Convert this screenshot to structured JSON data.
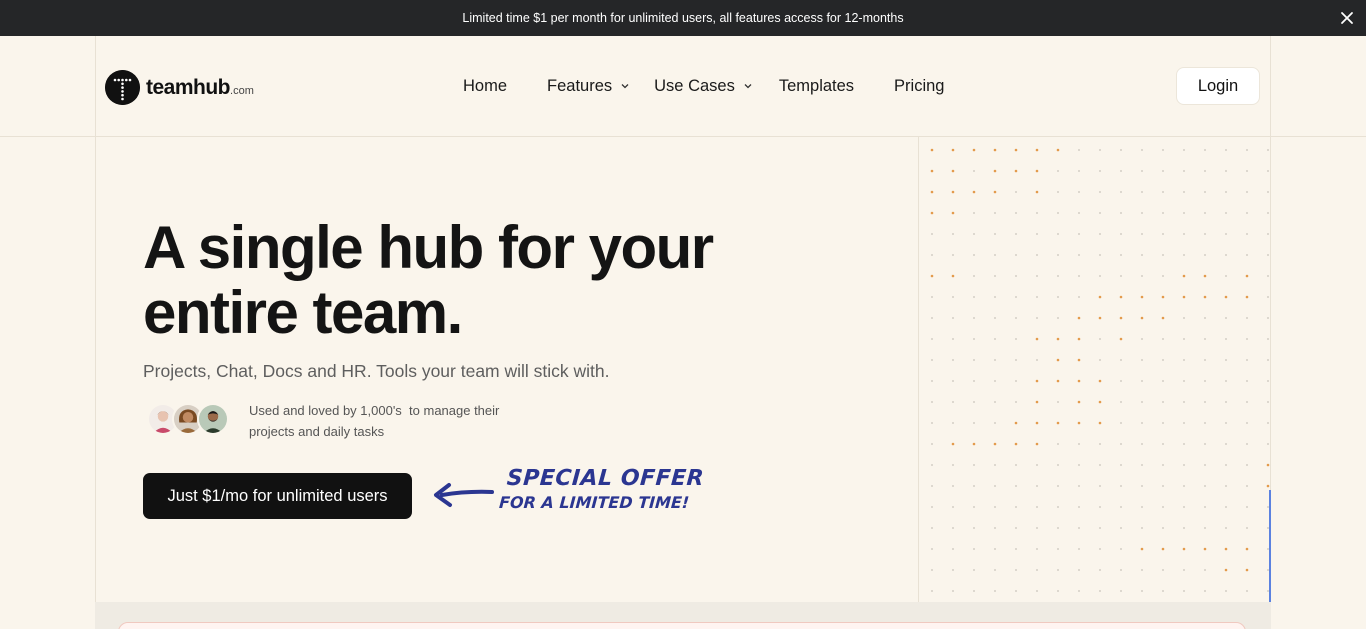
{
  "announcement": {
    "text": "Limited time $1 per month for unlimited users, all features access for 12-months",
    "close_icon": "close-icon"
  },
  "brand": {
    "name": "teamhub",
    "suffix": ".com",
    "logo_icon": "teamhub-logo-icon"
  },
  "nav": {
    "items": [
      {
        "label": "Home",
        "has_dropdown": false
      },
      {
        "label": "Features",
        "has_dropdown": true
      },
      {
        "label": "Use Cases",
        "has_dropdown": true
      },
      {
        "label": "Templates",
        "has_dropdown": false
      },
      {
        "label": "Pricing",
        "has_dropdown": false
      }
    ],
    "login_label": "Login"
  },
  "hero": {
    "title_line1": "A single hub for your",
    "title_line2": "entire team.",
    "subtitle": "Projects, Chat, Docs and HR. Tools your team will stick with.",
    "social_proof_line1": "Used and loved by 1,000's  to manage their",
    "social_proof_line2": "projects and daily tasks",
    "cta_label": "Just $1/mo for unlimited users",
    "offer_line1": "SPECIAL OFFER",
    "offer_line2": "FOR A LIMITED TIME!"
  },
  "colors": {
    "background": "#faf5ec",
    "announcement_bg": "#252628",
    "cta_bg": "#111111",
    "offer_text": "#2b3691",
    "dot_orange": "#e39a4c",
    "dot_grey": "#c9c4bb"
  }
}
